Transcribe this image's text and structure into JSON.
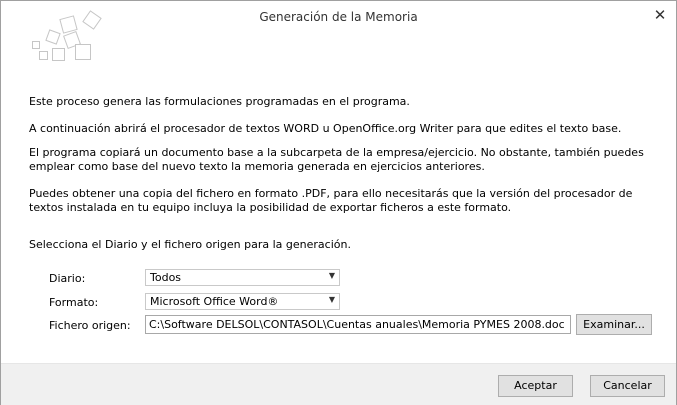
{
  "window": {
    "title": "Generación de la Memoria",
    "close_icon": "close-icon"
  },
  "body": {
    "paragraphs": [
      "Este proceso genera las formulaciones programadas en el programa.",
      "A continuación abrirá el procesador de textos WORD u OpenOffice.org Writer para que edites el texto base.",
      "El programa copiará un documento base a la subcarpeta de la empresa/ejercicio. No obstante, también puedes emplear como base del nuevo texto la memoria generada en ejercicios anteriores.",
      "Puedes obtener una copia del fichero en formato .PDF, para ello necesitarás que la versión del procesador de textos instalada en tu equipo incluya la posibilidad de exportar ficheros a este formato.",
      "Selecciona el Diario y el fichero origen para la generación."
    ]
  },
  "form": {
    "diario_label": "Diario:",
    "diario_value": "Todos",
    "formato_label": "Formato:",
    "formato_value": "Microsoft Office Word®",
    "fichero_label": "Fichero origen:",
    "fichero_value": "C:\\Software DELSOL\\CONTASOL\\Cuentas anuales\\Memoria PYMES 2008.doc",
    "examinar_label": "Examinar..."
  },
  "footer": {
    "accept_label": "Aceptar",
    "cancel_label": "Cancelar"
  }
}
